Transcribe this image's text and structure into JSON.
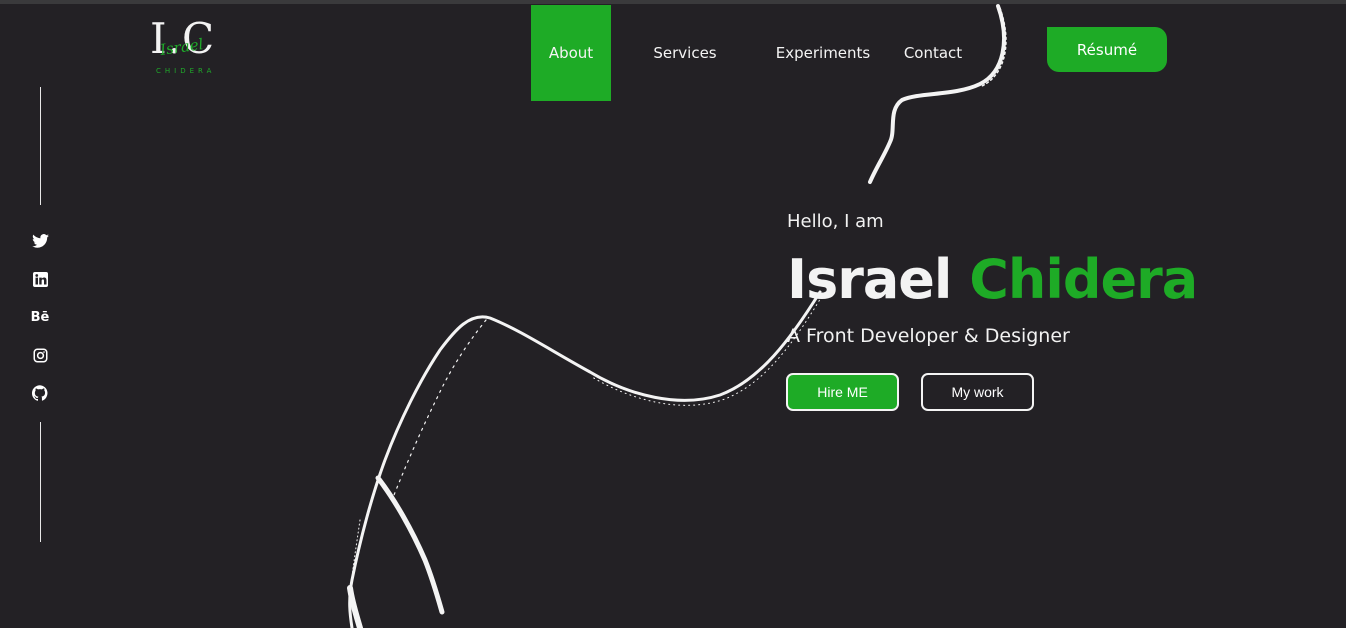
{
  "logo": {
    "mark": "I.C",
    "script": "Israel",
    "sub": "CHIDERA"
  },
  "nav": {
    "items": [
      {
        "label": "About",
        "active": true
      },
      {
        "label": "Services"
      },
      {
        "label": "Experiments"
      },
      {
        "label": "Contact"
      }
    ],
    "resume_label": "Résumé"
  },
  "social": {
    "items": [
      {
        "icon": "twitter-icon"
      },
      {
        "icon": "linkedin-icon"
      },
      {
        "icon": "behance-icon",
        "text": "Bē"
      },
      {
        "icon": "instagram-icon"
      },
      {
        "icon": "github-icon"
      }
    ]
  },
  "hero": {
    "greeting": "Hello, I am",
    "first_name": "Israel",
    "last_name": "Chidera",
    "role": "A Front Developer & Designer",
    "hire_label": "Hire ME",
    "work_label": "My work"
  },
  "colors": {
    "background": "#232125",
    "accent": "#1eab26",
    "text": "#f2f2f2"
  }
}
